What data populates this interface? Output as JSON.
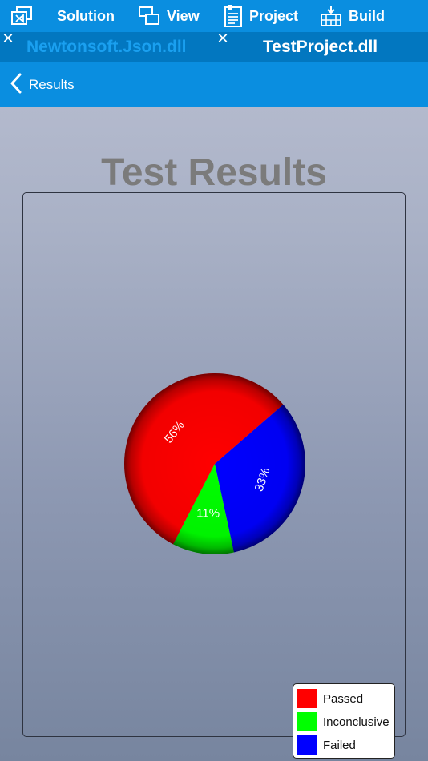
{
  "toolbar": {
    "items": [
      {
        "label": "",
        "icon": "visual-studio-icon"
      },
      {
        "label": "Solution",
        "icon": "solution-icon"
      },
      {
        "label": "View",
        "icon": "view-icon"
      },
      {
        "label": "Project",
        "icon": "project-icon"
      },
      {
        "label": "Build",
        "icon": "build-icon"
      }
    ]
  },
  "tabs": [
    {
      "label": "Newtonsoft.Json.dll",
      "active": false
    },
    {
      "label": "TestProject.dll",
      "active": true
    }
  ],
  "nav": {
    "back_label": "Results"
  },
  "page": {
    "title": "Test Results"
  },
  "colors": {
    "accent": "#0a8ee0",
    "tab_bar": "#0277c0"
  },
  "chart_data": {
    "type": "pie",
    "slices": [
      {
        "label": "Passed",
        "value": 56,
        "display": "56%",
        "color": "#ff0000"
      },
      {
        "label": "Inconclusive",
        "value": 11,
        "display": "11%",
        "color": "#00ff00"
      },
      {
        "label": "Failed",
        "value": 33,
        "display": "33%",
        "color": "#0000ff"
      }
    ],
    "legend": {
      "placement": "bottom-right",
      "entries": [
        "Passed",
        "Inconclusive",
        "Failed"
      ]
    }
  }
}
